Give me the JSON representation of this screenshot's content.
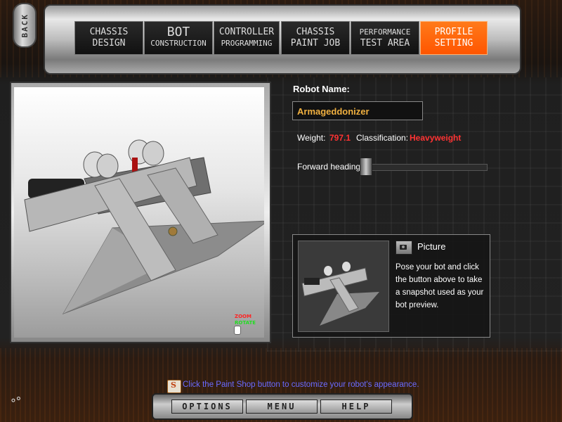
{
  "nav": {
    "back_label": "BACK",
    "tabs": [
      {
        "line1": "CHASSIS",
        "line2": "DESIGN"
      },
      {
        "line1": "BOT",
        "line2": "CONSTRUCTION"
      },
      {
        "line1": "CONTROLLER",
        "line2": "PROGRAMMING"
      },
      {
        "line1": "CHASSIS",
        "line2": "PAINT JOB"
      },
      {
        "line1": "PERFORMANCE",
        "line2": "TEST AREA"
      },
      {
        "line1": "PROFILE",
        "line2": "SETTING"
      }
    ],
    "active_tab": "PROFILE SETTING",
    "active_color": "#ff6600"
  },
  "viewport": {
    "zoom_hint": "ZOOM",
    "rotate_hint": "ROTATE"
  },
  "robot": {
    "name_label": "Robot Name:",
    "name_value": "Armageddonizer",
    "weight_label": "Weight:",
    "weight_value": "797.1",
    "classification_label": "Classification:",
    "classification_value": "Heavyweight",
    "heading_label": "Forward heading:",
    "value_color": "#ff3333",
    "name_color": "#f0b040"
  },
  "picture": {
    "title": "Picture",
    "description": "Pose your bot and click the button above to take a snapshot used as your bot preview.",
    "camera_icon": "camera-icon"
  },
  "tip": {
    "text": "Click the Paint Shop button to customize your robot's appearance."
  },
  "bottom": {
    "options_label": "OPTIONS",
    "menu_label": "MENU",
    "help_label": "HELP"
  }
}
